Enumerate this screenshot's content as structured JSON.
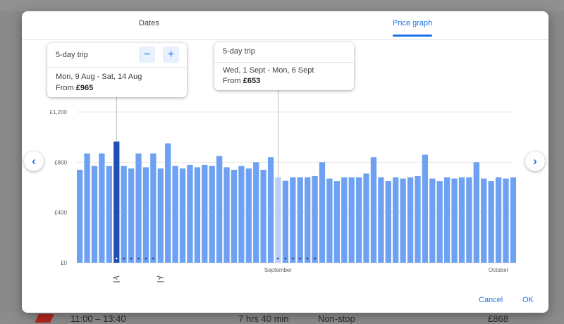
{
  "background": {
    "row": {
      "time": "11:00 – 13:40",
      "duration": "7 hrs 40 min",
      "stops": "Non-stop",
      "price": "£868"
    }
  },
  "tabs": [
    {
      "label": "Dates"
    },
    {
      "label": "Price graph",
      "selected": true
    }
  ],
  "tooltips": [
    {
      "title": "5-day trip",
      "dates": "Mon, 9 Aug - Sat, 14 Aug",
      "price_prefix": "From ",
      "price": "£965",
      "minus_label": "−",
      "plus_label": "+"
    },
    {
      "title": "5-day trip",
      "dates": "Wed, 1 Sept - Mon, 6 Sept",
      "price_prefix": "From ",
      "price": "£653"
    }
  ],
  "nav": {
    "prev_icon": "‹",
    "next_icon": "›"
  },
  "actions": {
    "cancel": "Cancel",
    "ok": "OK"
  },
  "colors": {
    "bar": "#6ea1f1",
    "bar_selected": "#1e4fb4",
    "bar_highlight": "#b9cff7",
    "accent": "#1a73e8"
  },
  "chart_data": {
    "type": "bar",
    "y_ticks": [
      "£1,200",
      "£800",
      "£400",
      "£0"
    ],
    "y_tick_values": [
      1200,
      800,
      400,
      0
    ],
    "ylim": [
      0,
      1200
    ],
    "x_labels": [
      {
        "label": "September",
        "index": 27
      },
      {
        "label": "October",
        "index": 57
      }
    ],
    "selected_index": 5,
    "highlight_index": 27,
    "trip_marker_indices": [
      5,
      11
    ],
    "values": [
      740,
      870,
      770,
      870,
      770,
      965,
      770,
      750,
      870,
      760,
      870,
      750,
      950,
      770,
      750,
      780,
      760,
      780,
      770,
      850,
      760,
      740,
      770,
      750,
      800,
      740,
      840,
      680,
      653,
      680,
      680,
      680,
      690,
      800,
      670,
      650,
      680,
      680,
      680,
      710,
      840,
      680,
      650,
      680,
      670,
      680,
      690,
      860,
      670,
      650,
      680,
      670,
      680,
      680,
      800,
      670,
      650,
      680,
      670,
      680
    ]
  }
}
